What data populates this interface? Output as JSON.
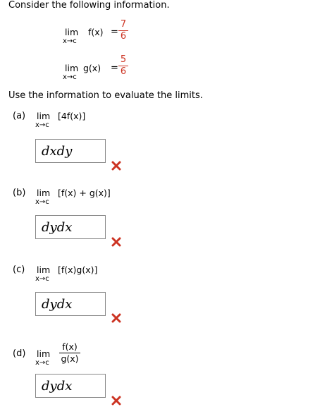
{
  "intro": "Consider the following information.",
  "given": [
    {
      "lim": "lim",
      "func": "f(x)",
      "sub": "x→c",
      "eq": "=",
      "num": "7",
      "den": "6"
    },
    {
      "lim": "lim",
      "func": "g(x)",
      "sub": "x→c",
      "eq": "=",
      "num": "5",
      "den": "6"
    }
  ],
  "instruction": "Use the information to evaluate the limits.",
  "parts": [
    {
      "label": "(a)",
      "lim": "lim",
      "expr": "[4f(x)]",
      "sub": "x→c",
      "answer": "dxdy",
      "status": "incorrect"
    },
    {
      "label": "(b)",
      "lim": "lim",
      "expr": "[f(x) + g(x)]",
      "sub": "x→c",
      "answer": "dydx",
      "status": "incorrect"
    },
    {
      "label": "(c)",
      "lim": "lim",
      "expr": "[f(x)g(x)]",
      "sub": "x→c",
      "answer": "dydx",
      "status": "incorrect"
    },
    {
      "label": "(d)",
      "lim": "lim",
      "num": "f(x)",
      "den": "g(x)",
      "sub": "x→c",
      "answer": "dydx",
      "status": "incorrect"
    }
  ],
  "colors": {
    "incorrect_mark": "#cc3322",
    "link_fraction": "#cc3322"
  },
  "icons": {
    "incorrect": "x-mark-icon"
  }
}
